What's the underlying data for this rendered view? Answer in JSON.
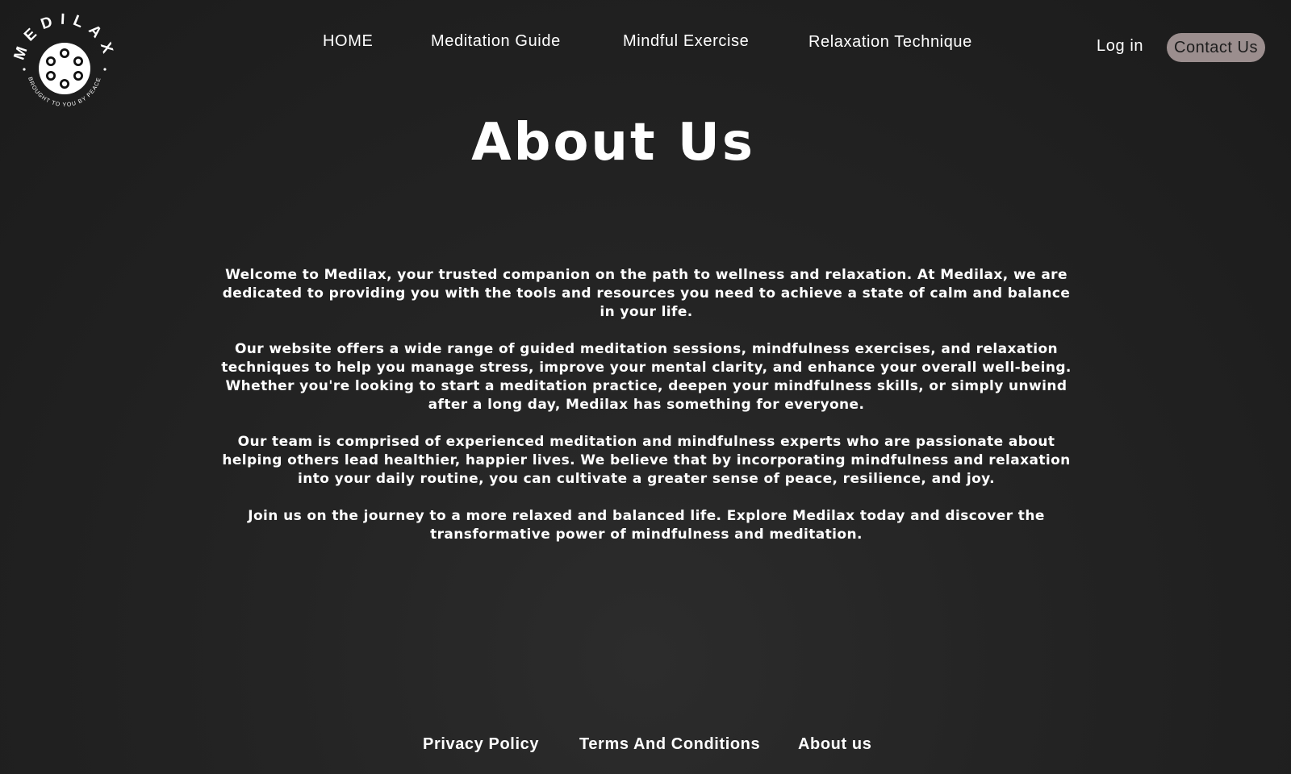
{
  "brand": {
    "name": "MEDILAX",
    "tagline": "BROUGHT TO YOU BY PEACE"
  },
  "nav": {
    "items": [
      {
        "label": "HOME"
      },
      {
        "label": "Meditation Guide"
      },
      {
        "label": "Mindful Exercise"
      },
      {
        "label": "Relaxation Technique"
      }
    ],
    "login_label": "Log in",
    "contact_label": "Contact Us"
  },
  "main": {
    "title": "About Us",
    "paragraphs": [
      "Welcome to Medilax, your trusted companion on the path to wellness and relaxation. At Medilax, we are dedicated to providing you with the tools and resources you need to achieve a state of calm and balance in your life.",
      "Our website offers a wide range of guided meditation sessions, mindfulness exercises, and relaxation techniques to help you manage stress, improve your mental clarity, and enhance your overall well-being. Whether you're looking to start a meditation practice, deepen your mindfulness skills, or simply unwind after a long day, Medilax has something for everyone.",
      "Our team is comprised of experienced meditation and mindfulness experts who are passionate about helping others lead healthier, happier lives. We believe that by incorporating mindfulness and relaxation into your daily routine, you can cultivate a greater sense of peace, resilience, and joy.",
      "Join us on the journey to a more relaxed and balanced life. Explore Medilax today and discover the transformative power of mindfulness and meditation."
    ]
  },
  "footer": {
    "links": [
      {
        "label": "Privacy Policy"
      },
      {
        "label": "Terms And Conditions"
      },
      {
        "label": "About us"
      }
    ]
  },
  "colors": {
    "background": "#1f1f1f",
    "text": "#ffffff",
    "contact_button_bg": "#9b8e8e",
    "contact_button_text": "#1c1c1c"
  },
  "icons": {
    "logo": "medilax-seed-logo"
  }
}
